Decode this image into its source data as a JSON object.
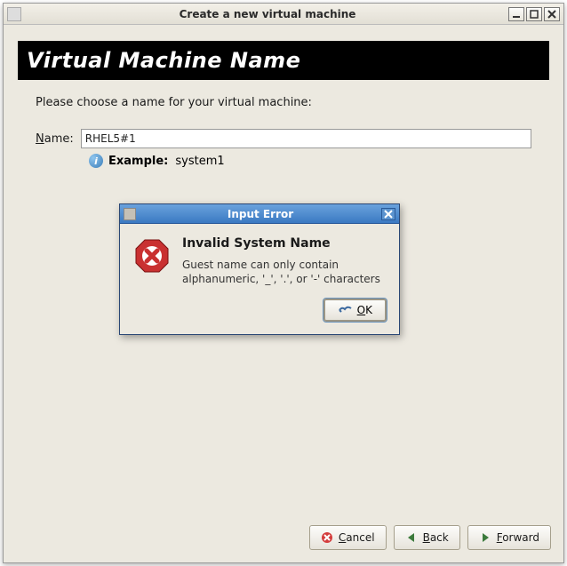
{
  "window": {
    "title": "Create a new virtual machine",
    "minimize": "_",
    "maximize": "□",
    "close": "×"
  },
  "banner": "Virtual Machine Name",
  "prompt": "Please choose a name for your virtual machine:",
  "name": {
    "label_pre": "N",
    "label_post": "ame:",
    "value": "RHEL5#1"
  },
  "example": {
    "label": "Example:",
    "value": "system1"
  },
  "buttons": {
    "cancel_pre": "",
    "cancel_ul": "C",
    "cancel_post": "ancel",
    "back_pre": "",
    "back_ul": "B",
    "back_post": "ack",
    "forward_pre": "",
    "forward_ul": "F",
    "forward_post": "orward"
  },
  "dialog": {
    "title": "Input Error",
    "heading": "Invalid System Name",
    "message": "Guest name can only contain alphanumeric, '_', '.', or '-' characters",
    "ok_pre": "",
    "ok_ul": "O",
    "ok_post": "K"
  }
}
